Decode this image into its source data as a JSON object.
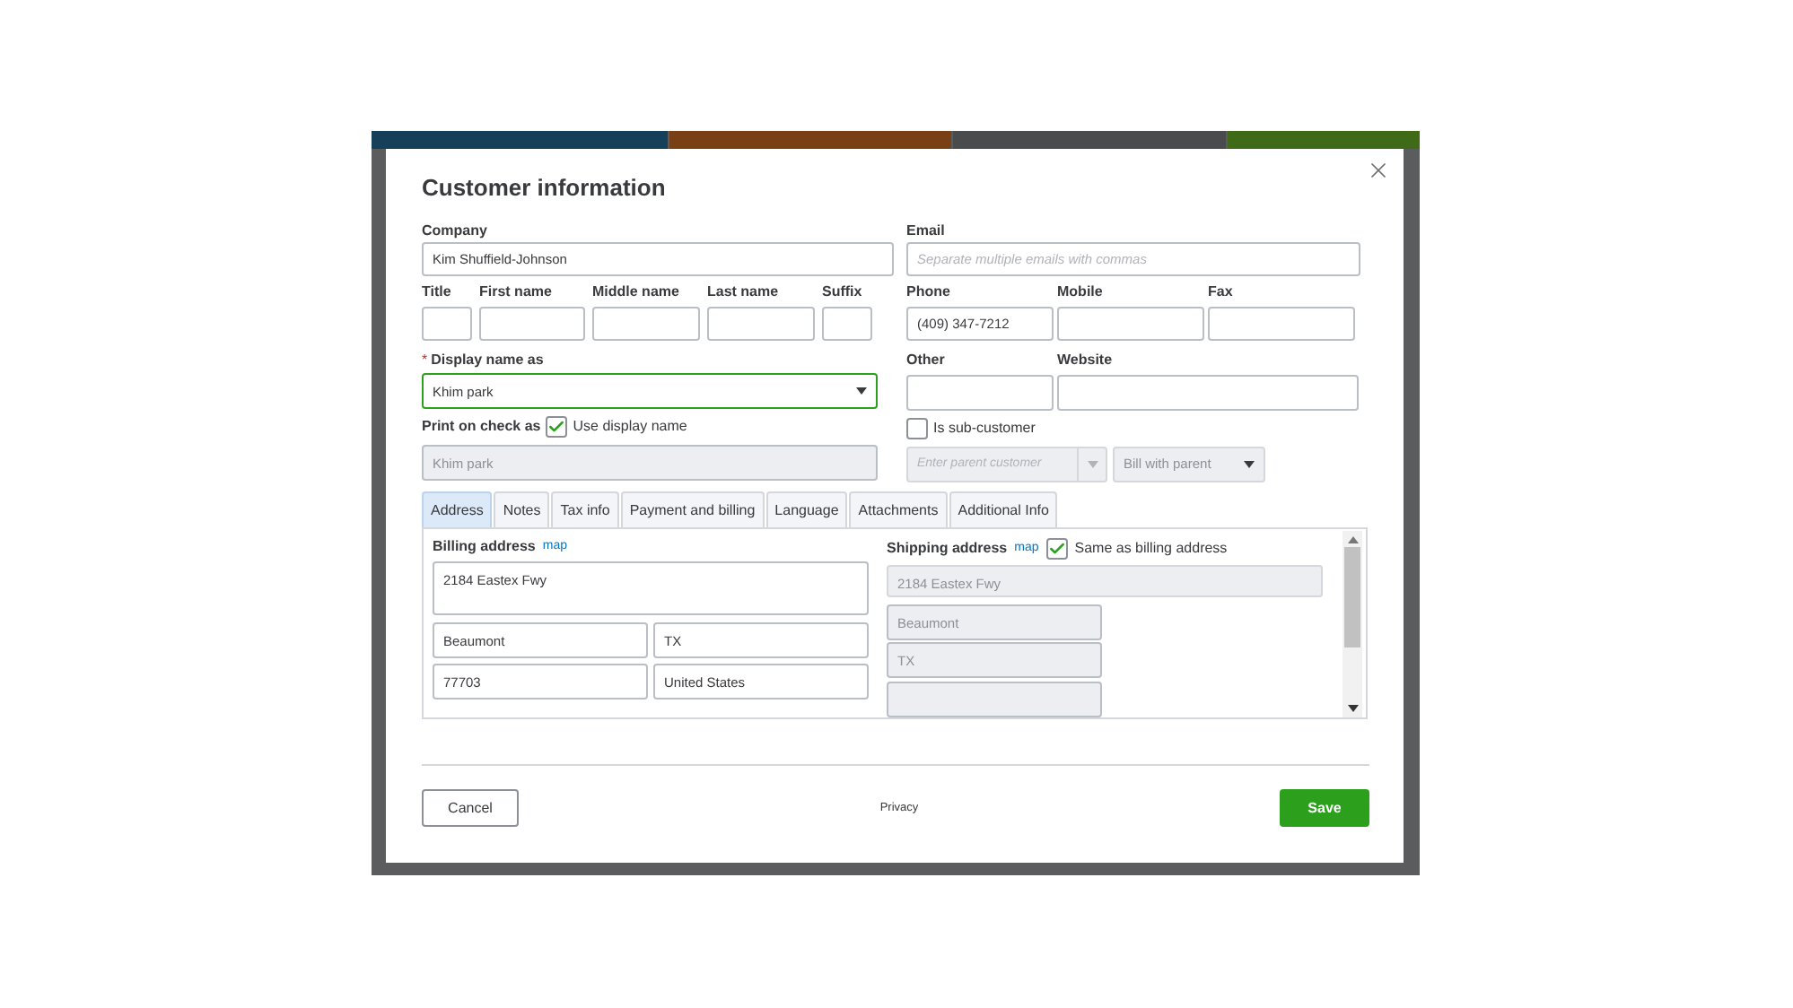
{
  "dialog": {
    "title": "Customer information"
  },
  "company": {
    "label": "Company",
    "value": "Kim Shuffield-Johnson"
  },
  "email": {
    "label": "Email",
    "placeholder": "Separate multiple emails with commas"
  },
  "name_fields": [
    {
      "label": "Title"
    },
    {
      "label": "First name"
    },
    {
      "label": "Middle name"
    },
    {
      "label": "Last name"
    },
    {
      "label": "Suffix"
    }
  ],
  "phones": [
    {
      "label": "Phone",
      "value": "(409) 347-7212"
    },
    {
      "label": "Mobile"
    },
    {
      "label": "Fax"
    }
  ],
  "display_name": {
    "label": "Display name as",
    "required_mark": "*",
    "value": "Khim park"
  },
  "other_fields": [
    {
      "label": "Other"
    },
    {
      "label": "Website"
    }
  ],
  "print_on_check": {
    "label": "Print on check as",
    "checkbox_label": "Use display name",
    "checked": true,
    "value": "Khim park"
  },
  "sub_customer": {
    "label": "Is sub-customer",
    "checked": false,
    "parent_placeholder": "Enter parent customer",
    "billing": "Bill with parent"
  },
  "tabs": [
    {
      "label": "Address",
      "selected": true
    },
    {
      "label": "Notes",
      "selected": false
    },
    {
      "label": "Tax info",
      "selected": false
    },
    {
      "label": "Payment and billing",
      "selected": false
    },
    {
      "label": "Language",
      "selected": false
    },
    {
      "label": "Attachments",
      "selected": false
    },
    {
      "label": "Additional Info",
      "selected": false
    }
  ],
  "billing": {
    "label": "Billing address",
    "link": "map",
    "street": "2184 Eastex Fwy",
    "city": "Beaumont",
    "state": "TX",
    "zip": "77703",
    "country": "United States"
  },
  "shipping": {
    "label": "Shipping address",
    "link": "map",
    "same_label": "Same as billing address",
    "same_checked": true,
    "street": "2184 Eastex Fwy",
    "city": "Beaumont",
    "state": "TX"
  },
  "footer": {
    "cancel": "Cancel",
    "privacy": "Privacy",
    "save": "Save"
  }
}
